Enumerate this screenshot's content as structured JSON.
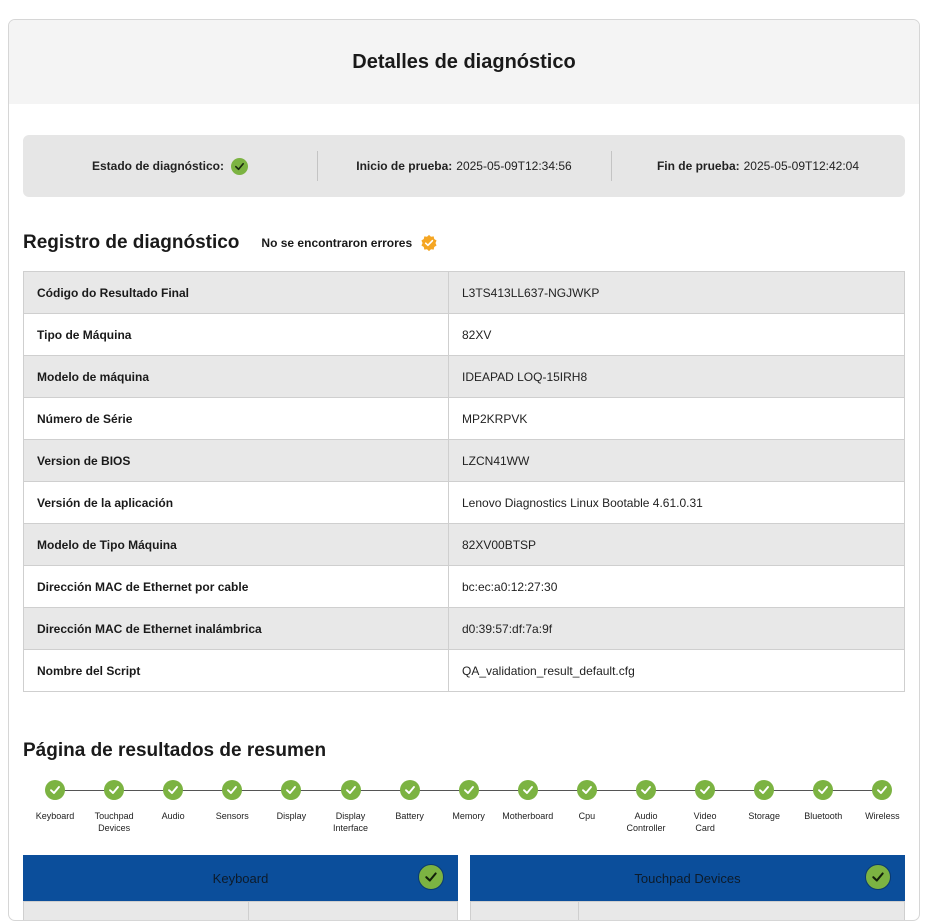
{
  "header": {
    "title": "Detalles de diagnóstico"
  },
  "status": {
    "state_label": "Estado de diagnóstico:",
    "start_label": "Inicio de prueba:",
    "start_value": "2025-05-09T12:34:56",
    "end_label": "Fin de prueba:",
    "end_value": "2025-05-09T12:42:04",
    "state_icon": "check-circle-icon"
  },
  "log": {
    "title": "Registro de diagnóstico",
    "no_errors": "No se encontraron errores",
    "badge_icon": "verified-badge-icon",
    "badge_color": "#f5a623",
    "rows": [
      {
        "key": "Código do Resultado Final",
        "value": "L3TS413LL637-NGJWKP"
      },
      {
        "key": "Tipo de Máquina",
        "value": "82XV"
      },
      {
        "key": "Modelo de máquina",
        "value": "IDEAPAD LOQ-15IRH8"
      },
      {
        "key": "Número de Série",
        "value": "MP2KRPVK"
      },
      {
        "key": "Version de BIOS",
        "value": "LZCN41WW"
      },
      {
        "key": "Versión de la aplicación",
        "value": "Lenovo Diagnostics Linux Bootable 4.61.0.31"
      },
      {
        "key": "Modelo de Tipo Máquina",
        "value": "82XV00BTSP"
      },
      {
        "key": "Dirección MAC de Ethernet por cable",
        "value": "bc:ec:a0:12:27:30"
      },
      {
        "key": "Dirección MAC de Ethernet inalámbrica",
        "value": "d0:39:57:df:7a:9f"
      },
      {
        "key": "Nombre del Script",
        "value": "QA_validation_result_default.cfg"
      }
    ]
  },
  "summary": {
    "title": "Página de resultados de resumen",
    "steps": [
      {
        "line1": "Keyboard",
        "line2": ""
      },
      {
        "line1": "Touchpad",
        "line2": "Devices"
      },
      {
        "line1": "Audio",
        "line2": ""
      },
      {
        "line1": "Sensors",
        "line2": ""
      },
      {
        "line1": "Display",
        "line2": ""
      },
      {
        "line1": "Display",
        "line2": "Interface"
      },
      {
        "line1": "Battery",
        "line2": ""
      },
      {
        "line1": "Memory",
        "line2": ""
      },
      {
        "line1": "Motherboard",
        "line2": ""
      },
      {
        "line1": "Cpu",
        "line2": ""
      },
      {
        "line1": "Audio",
        "line2": "Controller"
      },
      {
        "line1": "Video",
        "line2": "Card"
      },
      {
        "line1": "Storage",
        "line2": ""
      },
      {
        "line1": "Bluetooth",
        "line2": ""
      },
      {
        "line1": "Wireless",
        "line2": ""
      }
    ],
    "cards": [
      {
        "title": "Keyboard"
      },
      {
        "title": "Touchpad Devices"
      }
    ],
    "pass_color": "#7cb342",
    "card_color": "#0b4e9b"
  }
}
